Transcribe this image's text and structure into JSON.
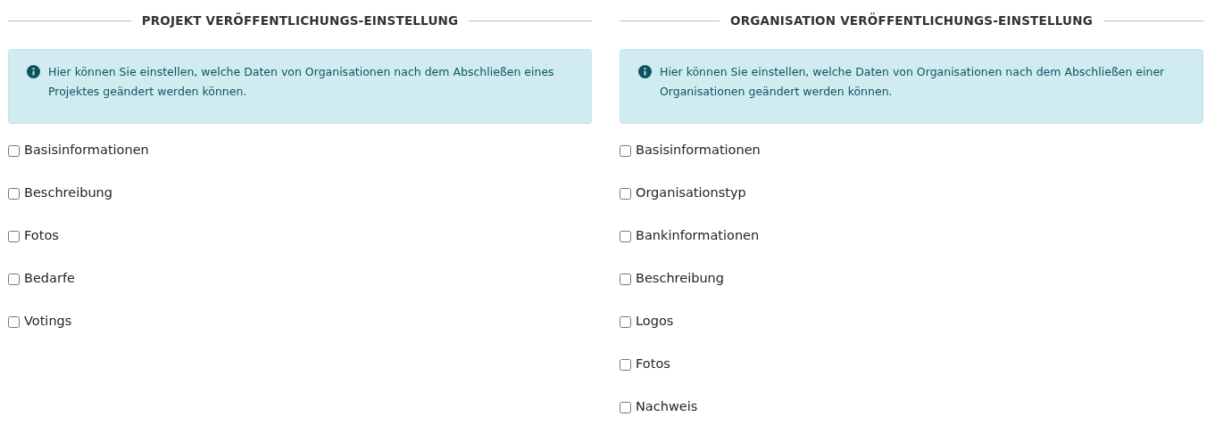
{
  "sections": [
    {
      "title": "PROJEKT VERÖFFENTLICHUNGS-EINSTELLUNG",
      "info": "Hier können Sie einstellen, welche Daten von Organisationen nach dem Abschließen eines Projektes geändert werden können.",
      "options": [
        {
          "label": "Basisinformationen",
          "checked": false
        },
        {
          "label": "Beschreibung",
          "checked": false
        },
        {
          "label": "Fotos",
          "checked": false
        },
        {
          "label": "Bedarfe",
          "checked": false
        },
        {
          "label": "Votings",
          "checked": false
        }
      ]
    },
    {
      "title": "ORGANISATION VERÖFFENTLICHUNGS-EINSTELLUNG",
      "info": "Hier können Sie einstellen, welche Daten von Organisationen nach dem Abschließen einer Organisationen geändert werden können.",
      "options": [
        {
          "label": "Basisinformationen",
          "checked": false
        },
        {
          "label": "Organisationstyp",
          "checked": false
        },
        {
          "label": "Bankinformationen",
          "checked": false
        },
        {
          "label": "Beschreibung",
          "checked": false
        },
        {
          "label": "Logos",
          "checked": false
        },
        {
          "label": "Fotos",
          "checked": false
        },
        {
          "label": "Nachweis",
          "checked": false
        }
      ]
    }
  ]
}
